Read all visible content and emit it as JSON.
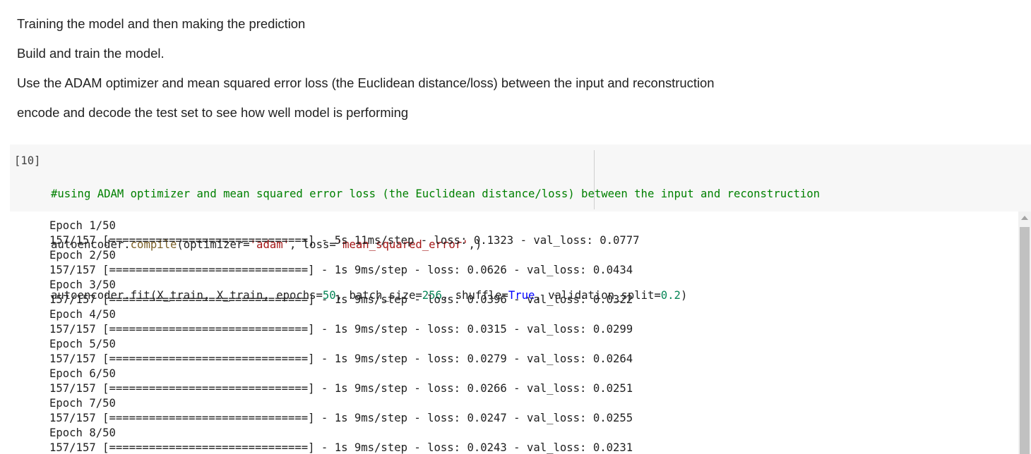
{
  "markdown": {
    "lines": [
      "Training the model and then making the prediction",
      "Build and train the model.",
      "Use the ADAM optimizer and mean squared error loss (the Euclidean distance/loss) between the input and reconstruction",
      "encode and decode the test set to see how well model is performing"
    ]
  },
  "code_cell": {
    "execution_count": "[10]",
    "line1": {
      "comment": "#using ADAM optimizer and mean squared error loss (the Euclidean distance/loss) between the input and reconstruction"
    },
    "line2": {
      "obj": "autoencoder.",
      "method": "compile",
      "arg1": "(optimizer=",
      "str1": "'adam'",
      "arg2": ", loss=",
      "str2": "'mean_squared_error'",
      "end": ",)"
    },
    "line3": {
      "p1": "autoencoder.fit(X_train, X_train, epochs=",
      "epochs": "50",
      "p2": ", batch_size=",
      "batch": "256",
      "p3": ", shuffle=",
      "shuffle": "True",
      "p4": ", validation_split=",
      "split": "0.2",
      "end": ")"
    }
  },
  "output": {
    "lines": [
      "Epoch 1/50",
      "157/157 [==============================] - 5s 11ms/step - loss: 0.1323 - val_loss: 0.0777",
      "Epoch 2/50",
      "157/157 [==============================] - 1s 9ms/step - loss: 0.0626 - val_loss: 0.0434",
      "Epoch 3/50",
      "157/157 [==============================] - 1s 9ms/step - loss: 0.0396 - val_loss: 0.0322",
      "Epoch 4/50",
      "157/157 [==============================] - 1s 9ms/step - loss: 0.0315 - val_loss: 0.0299",
      "Epoch 5/50",
      "157/157 [==============================] - 1s 9ms/step - loss: 0.0279 - val_loss: 0.0264",
      "Epoch 6/50",
      "157/157 [==============================] - 1s 9ms/step - loss: 0.0266 - val_loss: 0.0251",
      "Epoch 7/50",
      "157/157 [==============================] - 1s 9ms/step - loss: 0.0247 - val_loss: 0.0255",
      "Epoch 8/50",
      "157/157 [==============================] - 1s 9ms/step - loss: 0.0243 - val_loss: 0.0231"
    ]
  },
  "colors": {
    "cell_background": "#f7f7f7",
    "comment": "#008000",
    "string": "#a31515",
    "number": "#098658",
    "keyword": "#0000ff",
    "function": "#795e26"
  },
  "icons": {
    "scroll_up": "scroll-up-arrow-icon"
  }
}
